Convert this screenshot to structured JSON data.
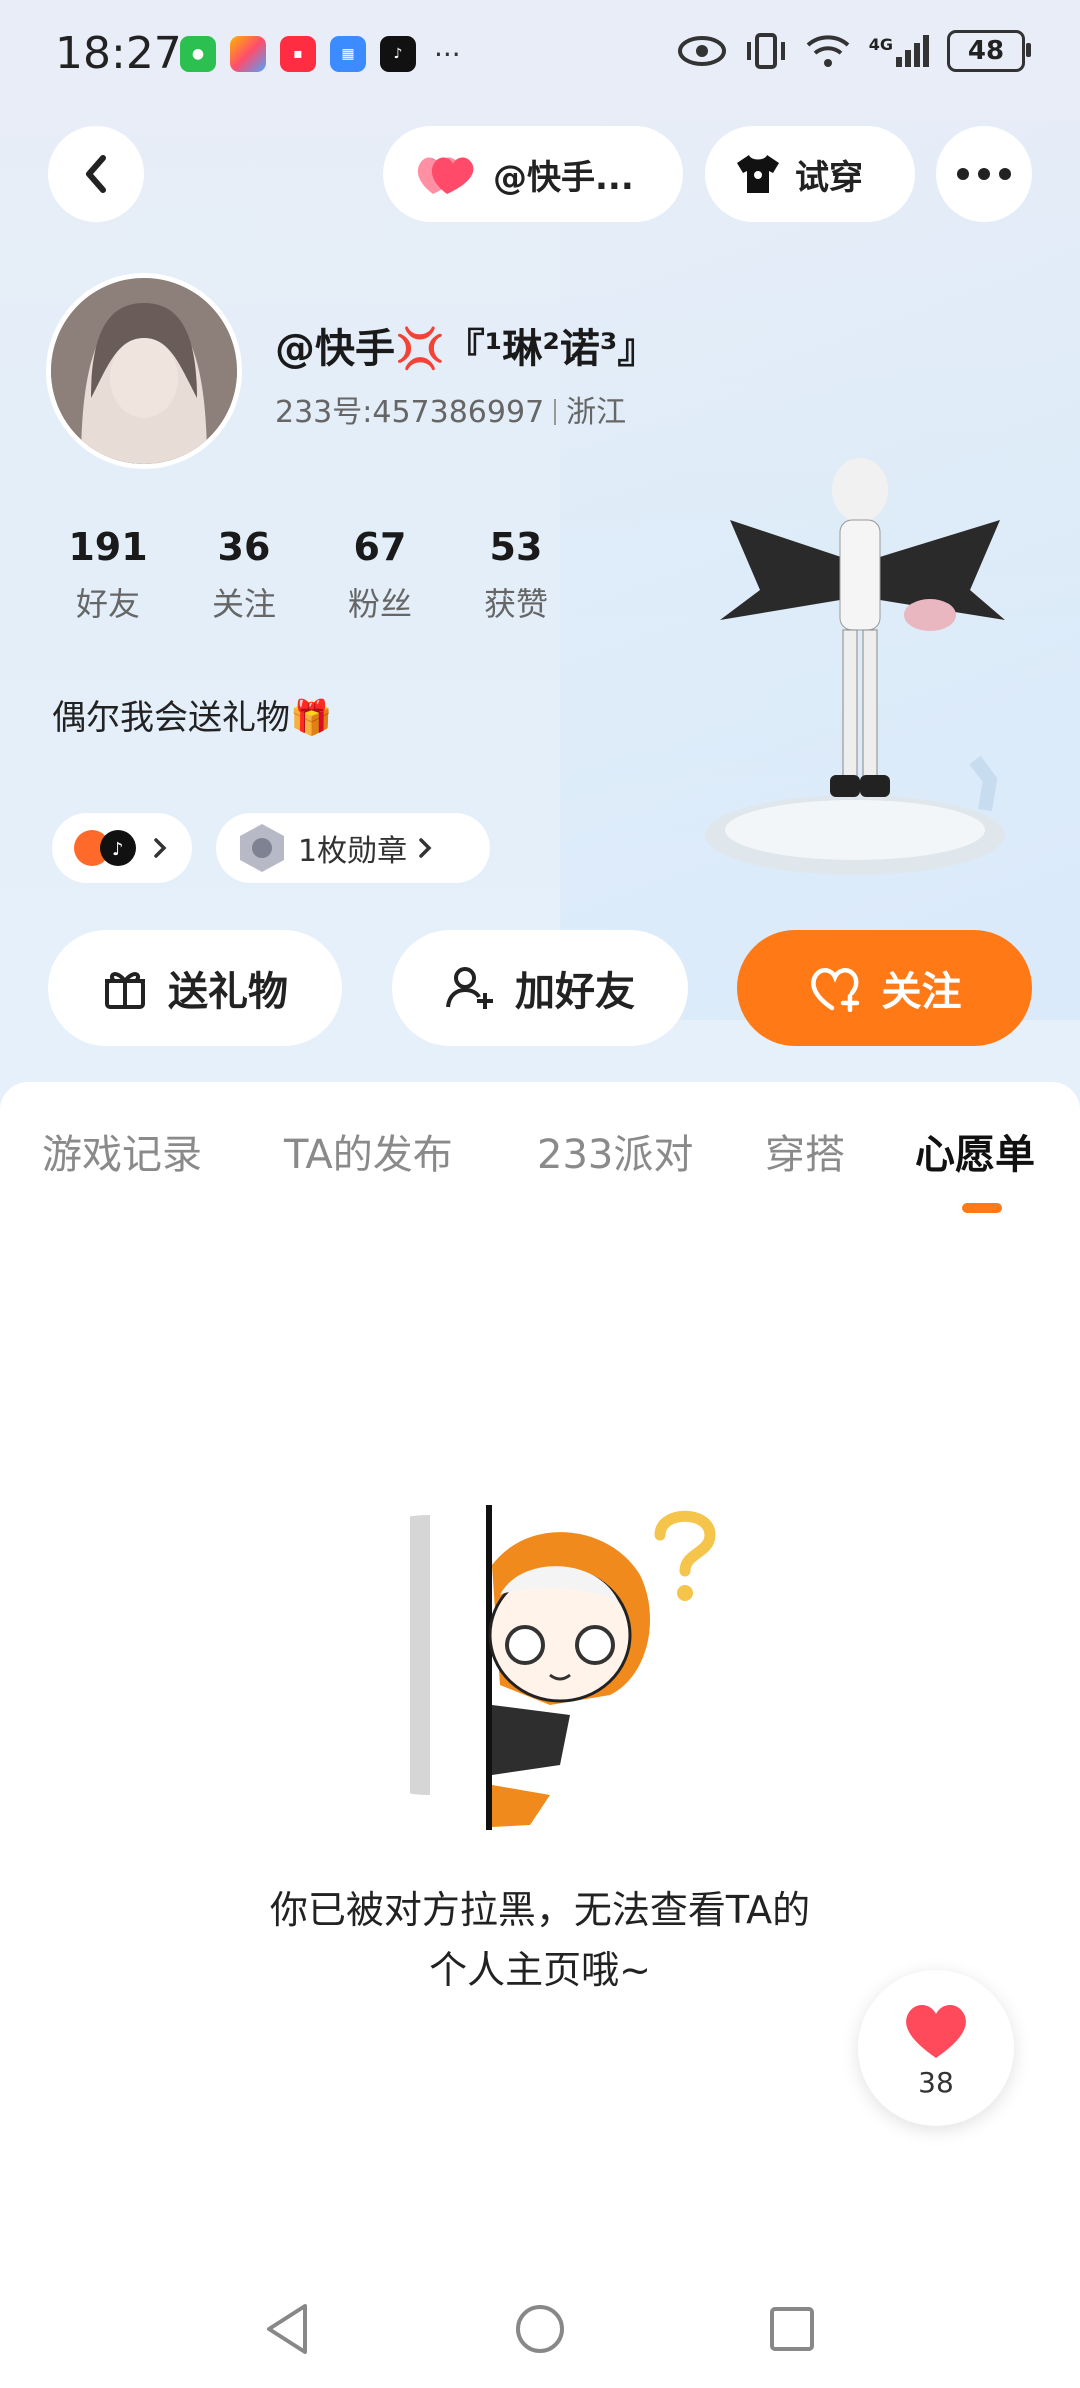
{
  "status_bar": {
    "time": "18:27",
    "battery": "48",
    "network": "4G",
    "app_icons": [
      "wechat-icon",
      "multicolor-app-icon",
      "xiaohongshu-icon",
      "calendar-icon",
      "douyin-icon"
    ],
    "more": "···"
  },
  "top_nav": {
    "back_icon": "chevron-left-icon",
    "lover_label": "@快手...",
    "tryon_label": "试穿",
    "more_icon": "more-dots-icon"
  },
  "profile": {
    "name": "@快手💢『¹琳²诺³』",
    "id_label": "233号:457386997",
    "region": "浙江",
    "bio": "偶尔我会送礼物🎁",
    "stats": [
      {
        "num": "191",
        "label": "好友"
      },
      {
        "num": "36",
        "label": "关注"
      },
      {
        "num": "67",
        "label": "粉丝"
      },
      {
        "num": "53",
        "label": "获赞"
      }
    ],
    "chips": {
      "badge_label": "1枚勋章"
    }
  },
  "actions": {
    "gift": "送礼物",
    "add_friend": "加好友",
    "follow": "关注"
  },
  "tabs": [
    "游戏记录",
    "TA的发布",
    "233派对",
    "穿搭",
    "心愿单"
  ],
  "active_tab": "心愿单",
  "empty_state": {
    "line1": "你已被对方拉黑，无法查看TA的",
    "line2": "个人主页哦~"
  },
  "like_fab": {
    "count": "38"
  },
  "colors": {
    "accent": "#ff7a16",
    "heart": "#ff4a5c"
  }
}
